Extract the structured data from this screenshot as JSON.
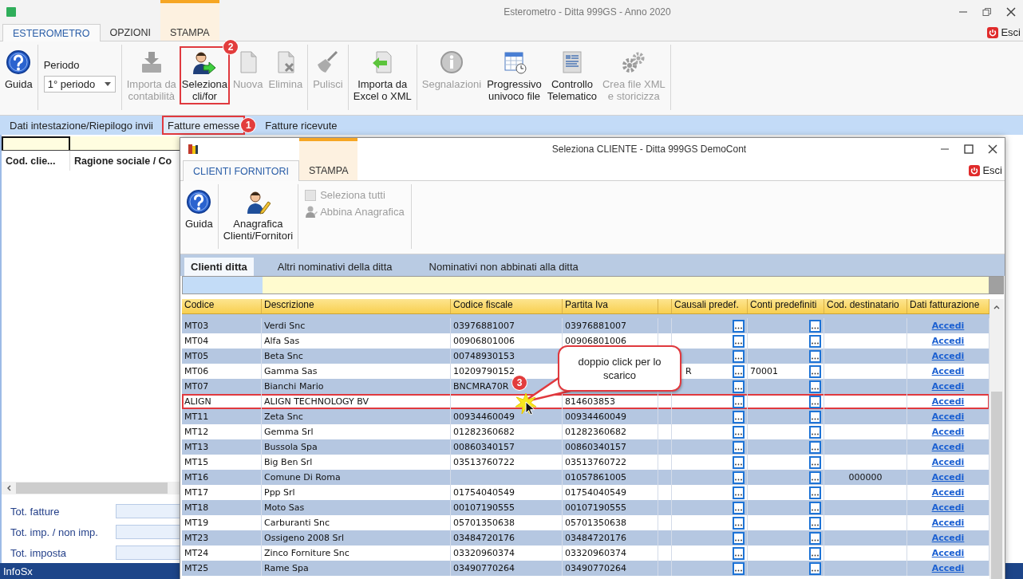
{
  "window": {
    "title": "Esterometro - Ditta 999GS - Anno 2020"
  },
  "tabs": [
    {
      "label": "ESTEROMETRO",
      "selected": true,
      "highlighted": false
    },
    {
      "label": "OPZIONI",
      "selected": false,
      "highlighted": false
    },
    {
      "label": "STAMPA",
      "selected": false,
      "highlighted": true
    }
  ],
  "exit_button": {
    "label": "Esci"
  },
  "ribbon": {
    "groups": [
      {
        "items": [
          {
            "kind": "button",
            "label": "Guida",
            "disabled": false,
            "marked": false
          }
        ]
      },
      {
        "items": [
          {
            "kind": "dropdown",
            "label": "Periodo",
            "value": "1° periodo"
          }
        ]
      },
      {
        "items": [
          {
            "kind": "button",
            "label": "Importa da\ncontabilità",
            "disabled": true,
            "marked": false
          },
          {
            "kind": "button",
            "label": "Seleziona\ncli/for",
            "disabled": false,
            "marked": true,
            "badge": "2"
          },
          {
            "kind": "button",
            "label": "Nuova",
            "disabled": true,
            "marked": false
          },
          {
            "kind": "button",
            "label": "Elimina",
            "disabled": true,
            "marked": false
          }
        ]
      },
      {
        "items": [
          {
            "kind": "button",
            "label": "Pulisci",
            "disabled": true,
            "marked": false
          }
        ]
      },
      {
        "items": [
          {
            "kind": "button",
            "label": "Importa da\nExcel o XML",
            "disabled": false,
            "marked": false
          }
        ]
      },
      {
        "items": [
          {
            "kind": "button",
            "label": "Segnalazioni",
            "disabled": true,
            "marked": false
          },
          {
            "kind": "button",
            "label": "Progressivo\nunivoco file",
            "disabled": false,
            "marked": false
          },
          {
            "kind": "button",
            "label": "Controllo\nTelematico",
            "disabled": false,
            "marked": false
          },
          {
            "kind": "button",
            "label": "Crea file XML\ne storicizza",
            "disabled": true,
            "marked": false
          }
        ]
      }
    ]
  },
  "nav": {
    "items": [
      {
        "label": "Dati intestazione/Riepilogo invii",
        "selected": false,
        "marked": false
      },
      {
        "label": "Fatture emesse",
        "selected": true,
        "marked": true,
        "badge": "1"
      },
      {
        "label": "Fatture ricevute",
        "selected": false,
        "marked": false
      }
    ]
  },
  "left_panel": {
    "columns": [
      "Cod. clie...",
      "Ragione sociale / Co"
    ],
    "totals": [
      {
        "label": "Tot. fatture"
      },
      {
        "label": "Tot. imp. / non imp."
      },
      {
        "label": "Tot. imposta"
      }
    ]
  },
  "status_bar": {
    "text": "InfoSx"
  },
  "dialog": {
    "title": "Seleziona CLIENTE - Ditta 999GS DemoCont",
    "tabs": [
      {
        "label": "CLIENTI FORNITORI",
        "selected": true,
        "highlighted": false
      },
      {
        "label": "STAMPA",
        "selected": false,
        "highlighted": true
      }
    ],
    "exit_button": {
      "label": "Esci"
    },
    "ribbon": {
      "groups": [
        {
          "items": [
            {
              "kind": "button",
              "label": "Guida",
              "disabled": false,
              "marked": false
            }
          ]
        },
        {
          "items": [
            {
              "kind": "button",
              "label": "Anagrafica\nClienti/Fornitori",
              "disabled": false,
              "marked": false
            }
          ]
        },
        {
          "items": [
            {
              "kind": "checkbox",
              "label": "Seleziona tutti",
              "checked": false,
              "disabled": true
            },
            {
              "kind": "small_button",
              "label": "Abbina Anagrafica",
              "disabled": true
            }
          ]
        }
      ]
    },
    "subtabs": [
      {
        "label": "Clienti ditta",
        "selected": true
      },
      {
        "label": "Altri nominativi della ditta",
        "selected": false
      },
      {
        "label": "Nominativi non abbinati alla ditta",
        "selected": false
      }
    ],
    "table": {
      "columns": [
        "Codice",
        "Descrizione",
        "Codice fiscale",
        "Partita Iva",
        "Causali predef.",
        "Conti predefiniti",
        "Cod. destinatario",
        "Dati fatturazione"
      ],
      "rows": [
        {
          "code": "MT03",
          "description": "Verdi Snc",
          "tax_code": "03976881007",
          "vat_number": "03976881007",
          "billing_link": "Accedi",
          "marked": false
        },
        {
          "code": "MT04",
          "description": "Alfa Sas",
          "tax_code": "00906801006",
          "vat_number": "00906801006",
          "billing_link": "Accedi",
          "marked": false
        },
        {
          "code": "MT05",
          "description": "Beta Snc",
          "tax_code": "00748930153",
          "billing_link": "Accedi",
          "marked": false
        },
        {
          "code": "MT06",
          "description": "Gamma Sas",
          "tax_code": "10209790152",
          "default_reasons": "R",
          "default_accounts": "70001",
          "billing_link": "Accedi",
          "marked": false
        },
        {
          "code": "MT07",
          "description": "Bianchi Mario",
          "tax_code": "BNCMRA70R",
          "billing_link": "Accedi",
          "marked": false
        },
        {
          "code": "ALIGN",
          "description": "ALIGN TECHNOLOGY BV",
          "vat_number": "814603853",
          "billing_link": "Accedi",
          "marked": true
        },
        {
          "code": "MT11",
          "description": "Zeta Snc",
          "tax_code": "00934460049",
          "vat_number": "00934460049",
          "billing_link": "Accedi",
          "marked": false
        },
        {
          "code": "MT12",
          "description": "Gemma Srl",
          "tax_code": "01282360682",
          "vat_number": "01282360682",
          "billing_link": "Accedi",
          "marked": false
        },
        {
          "code": "MT13",
          "description": "Bussola Spa",
          "tax_code": "00860340157",
          "vat_number": "00860340157",
          "billing_link": "Accedi",
          "marked": false
        },
        {
          "code": "MT15",
          "description": "Big Ben Srl",
          "tax_code": "03513760722",
          "vat_number": "03513760722",
          "billing_link": "Accedi",
          "marked": false
        },
        {
          "code": "MT16",
          "description": "Comune Di Roma",
          "vat_number": "01057861005",
          "recipient_code": "000000",
          "billing_link": "Accedi",
          "marked": false
        },
        {
          "code": "MT17",
          "description": "Ppp Srl",
          "tax_code": "01754040549",
          "vat_number": "01754040549",
          "billing_link": "Accedi",
          "marked": false
        },
        {
          "code": "MT18",
          "description": "Moto Sas",
          "tax_code": "00107190555",
          "vat_number": "00107190555",
          "billing_link": "Accedi",
          "marked": false
        },
        {
          "code": "MT19",
          "description": "Carburanti Snc",
          "tax_code": "05701350638",
          "vat_number": "05701350638",
          "billing_link": "Accedi",
          "marked": false
        },
        {
          "code": "MT23",
          "description": "Ossigeno 2008 Srl",
          "tax_code": "03484720176",
          "vat_number": "03484720176",
          "billing_link": "Accedi",
          "marked": false
        },
        {
          "code": "MT24",
          "description": "Zinco Forniture Snc",
          "tax_code": "03320960374",
          "vat_number": "03320960374",
          "billing_link": "Accedi",
          "marked": false
        },
        {
          "code": "MT25",
          "description": "Rame Spa",
          "tax_code": "03490770264",
          "vat_number": "03490770264",
          "billing_link": "Accedi",
          "marked": false
        }
      ]
    },
    "callout": {
      "text": "doppio click per lo scarico",
      "badge": "3"
    }
  }
}
